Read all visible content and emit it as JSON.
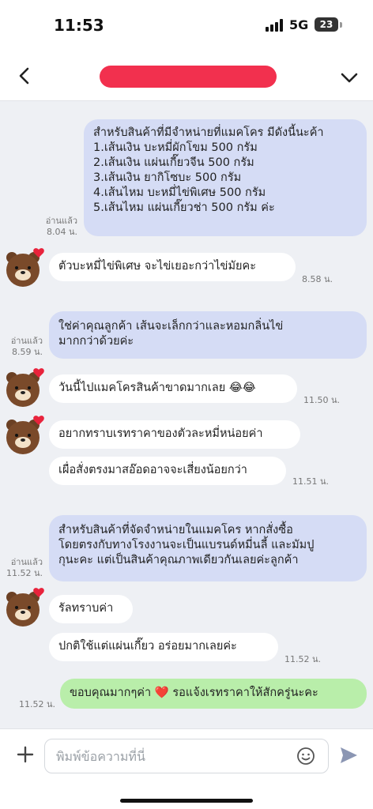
{
  "status_bar": {
    "time": "11:53",
    "network": "5G",
    "battery": "23"
  },
  "header": {
    "back_icon": "chevron-left-icon",
    "contact_name_redacted": true,
    "menu_icon": "chevron-down-icon"
  },
  "messages": [
    {
      "dir": "out",
      "lines": [
        "สำหรับสินค้าที่มีจำหน่ายที่แมคโคร มีดังนี้นะค้า",
        "1.เส้นเงิน บะหมี่ผักโขม 500 กรัม",
        "2.เส้นเงิน แผ่นเกี๊ยวจีน 500 กรัม",
        "3.เส้นเงิน ยากิโซบะ 500 กรัม",
        "4.เส้นไหม บะหมี่ไข่พิเศษ 500 กรัม",
        "5.เส้นไหม แผ่นเกี๊ยวช่า 500 กรัม ค่ะ"
      ],
      "read": "อ่านแล้ว",
      "time": "8.04 น."
    },
    {
      "dir": "in",
      "lines": [
        "ตัวบะหมี่ไข่พิเศษ จะไข่เยอะกว่าไข่มัยคะ"
      ],
      "time": "8.58 น."
    },
    {
      "dir": "out",
      "lines": [
        "ใช่ค่าคุณลูกค้า เส้นจะเล็กกว่าและหอมกลิ่นไข่",
        "มากกว่าด้วยค่ะ"
      ],
      "read": "อ่านแล้ว",
      "time": "8.59 น."
    },
    {
      "dir": "in",
      "lines": [
        "วันนี้ไปแมคโครสินค้าขาดมากเลย 😂😂"
      ],
      "time": "11.50 น."
    },
    {
      "dir": "in",
      "lines": [
        "อยากทราบเรทราคาของตัวละหมี่หน่อยค่า"
      ]
    },
    {
      "dir": "in",
      "lines": [
        "เผื่อสั่งตรงมาสอ๊อดอาจจะเสี่ยงน้อยกว่า"
      ],
      "time": "11.51 น."
    },
    {
      "dir": "out",
      "lines": [
        "สำหรับสินค้าที่จัดจำหน่ายในแมคโคร หากสั่งซื้อ",
        "โดยตรงกับทางโรงงานจะเป็นแบรนด์หมี่นลี้ และมัมปู",
        "กุนะคะ แต่เป็นสินค้าคุณภาพเดียวกันเลยค่ะลูกค้า"
      ],
      "read": "อ่านแล้ว",
      "time": "11.52 น."
    },
    {
      "dir": "in",
      "lines": [
        "รัลทราบค่า"
      ]
    },
    {
      "dir": "in",
      "lines": [
        "ปกติใช้แต่แผ่นเกี๊ยว อร่อยมากเลยค่ะ"
      ],
      "time": "11.52 น."
    },
    {
      "dir": "out-green",
      "lines": [
        "ขอบคุณมากๆค่า ❤️ รอแจ้งเรทราคาให้สักครู่นะคะ"
      ],
      "time": "11.52 น."
    }
  ],
  "input": {
    "placeholder": "พิมพ์ข้อความที่นี่",
    "plus_icon": "plus-icon",
    "emoji_icon": "smiley-icon",
    "send_icon": "send-icon"
  },
  "colors": {
    "outgoing_bubble": "#d5dcf5",
    "incoming_bubble": "#ffffff",
    "green_bubble": "#b9eeaa",
    "chat_background": "#eef0f4",
    "redaction": "#f2304e"
  }
}
